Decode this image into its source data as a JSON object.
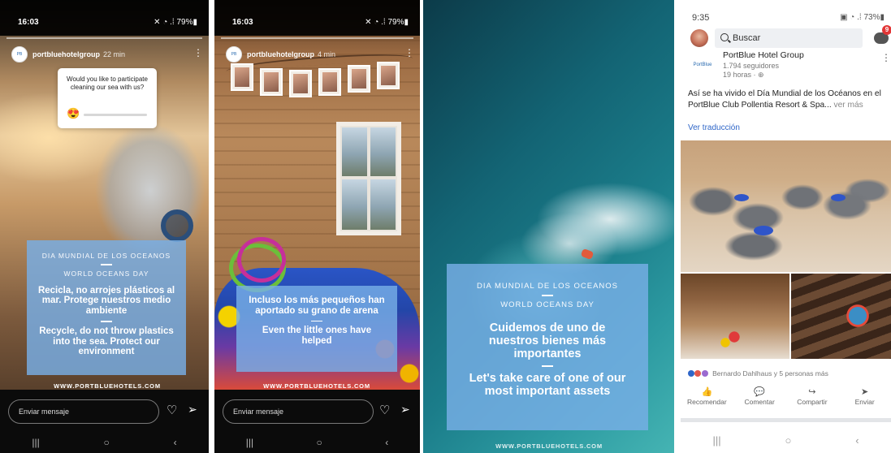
{
  "story1": {
    "status_time": "16:03",
    "status_right": "79%",
    "username": "portbluehotelgroup",
    "ago": "22 min",
    "poll_question": "Would you like to participate cleaning our sea with us?",
    "poll_emoji": "😍",
    "overlay_line1": "DIA MUNDIAL DE LOS OCEANOS",
    "overlay_line2": "WORLD OCEANS DAY",
    "overlay_es": "Recicla, no arrojes plásticos al mar. Protege nuestros medio ambiente",
    "overlay_en": "Recycle, do not throw plastics into the sea. Protect our environment",
    "website": "WWW.PORTBLUEHOTELS.COM",
    "message_placeholder": "Enviar mensaje"
  },
  "story2": {
    "status_time": "16:03",
    "status_right": "79%",
    "username": "portbluehotelgroup",
    "ago": "4 min",
    "overlay_es": "Incluso los más pequeños han aportado su grano de arena",
    "overlay_en": "Even the little ones have helped",
    "website": "WWW.PORTBLUEHOTELS.COM",
    "message_placeholder": "Enviar mensaje"
  },
  "story3": {
    "overlay_line1": "DIA MUNDIAL DE LOS OCEANOS",
    "overlay_line2": "WORLD OCEANS DAY",
    "overlay_es": "Cuidemos de uno de nuestros bienes más importantes",
    "overlay_en": "Let's take care of one of our most important assets",
    "website": "WWW.PORTBLUEHOTELS.COM"
  },
  "facebook": {
    "status_time": "9:35",
    "status_right": "73%",
    "search_placeholder": "Buscar",
    "messenger_badge": "9",
    "page_logo_text": "PortBlue",
    "page_name": "PortBlue Hotel Group",
    "followers": "1.794 seguidores",
    "post_time": "19 horas · ⊕",
    "caption": "Así se ha vivido el Día Mundial de los Océanos en el PortBlue Club Pollentia Resort & Spa...",
    "see_more": "ver más",
    "translate": "Ver traducción",
    "reactions": "Bernardo Dahlhaus y 5 personas más",
    "actions": [
      {
        "label": "Recomendar",
        "icon": "thumbs-up-icon",
        "glyph": "👍"
      },
      {
        "label": "Comentar",
        "icon": "comment-icon",
        "glyph": "💬"
      },
      {
        "label": "Compartir",
        "icon": "share-icon",
        "glyph": "↪"
      },
      {
        "label": "Enviar",
        "icon": "send-icon",
        "glyph": "➤"
      }
    ]
  },
  "nav": {
    "recents": "|||",
    "home": "○",
    "back": "‹"
  },
  "colors": {
    "overlay_blue": "#78afe6",
    "fb_blue": "#2f66c8",
    "badge_red": "#e23636"
  }
}
